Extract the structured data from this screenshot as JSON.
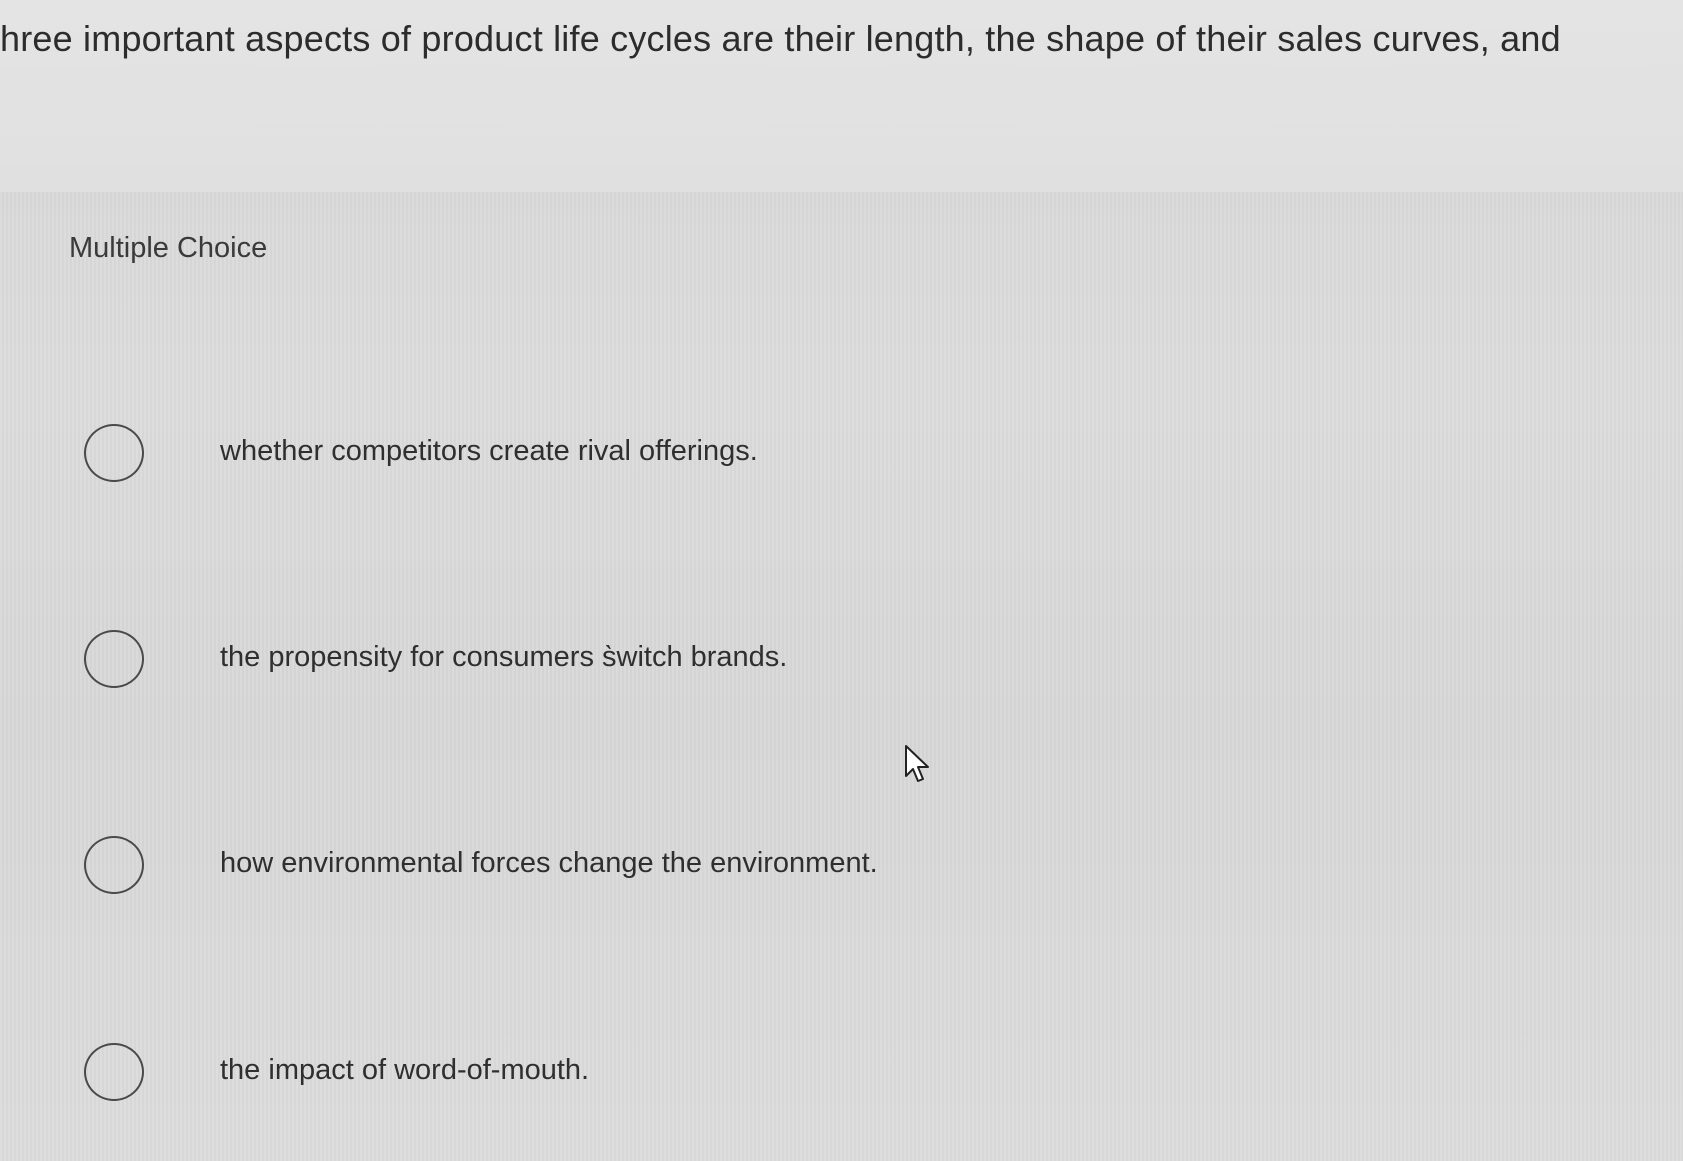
{
  "question": {
    "text": "hree important aspects of product life cycles are their length, the shape of their sales curves, and"
  },
  "section": {
    "label": "Multiple Choice"
  },
  "options": [
    {
      "text": "whether competitors create rival offerings."
    },
    {
      "text": "the propensity for consumers s̀witch brands."
    },
    {
      "text": "how environmental forces change the environment."
    },
    {
      "text": "the impact of word-of-mouth."
    }
  ],
  "icons": {
    "cursor": "mouse-pointer-icon",
    "radio": "radio-unchecked-icon"
  },
  "colors": {
    "background": "#dadada",
    "text": "#2e2e2e",
    "radio_border": "#4a4a4a"
  }
}
